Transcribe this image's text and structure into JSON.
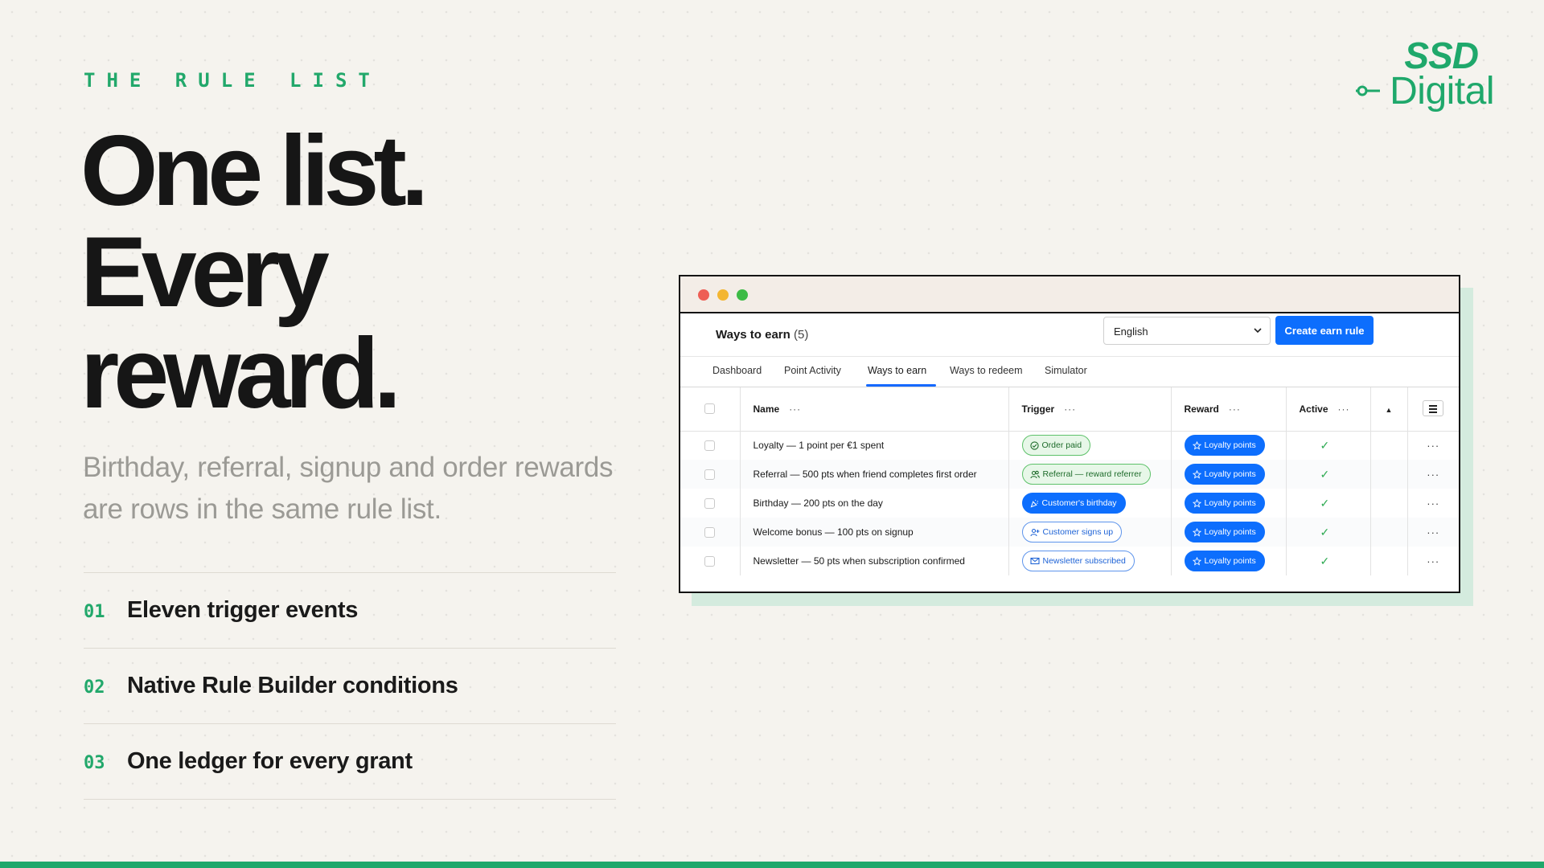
{
  "slide": {
    "eyebrow": "THE RULE LIST",
    "headline": [
      "One list.",
      "Every",
      "reward."
    ],
    "subtitle": "Birthday, referral, signup and order rewards are rows in the same rule list.",
    "features": [
      {
        "num": "01",
        "text": "Eleven trigger events"
      },
      {
        "num": "02",
        "text": "Native Rule Builder conditions"
      },
      {
        "num": "03",
        "text": "One ledger for every grant"
      }
    ]
  },
  "logo": {
    "line1": "SSD",
    "line2": "Digital"
  },
  "colors": {
    "accent": "#1fa86b",
    "primary_button": "#0d6efd",
    "shadow": "#d4ebde"
  },
  "app": {
    "title": "Ways to earn",
    "count": "(5)",
    "language_select": "English",
    "create_button": "Create earn rule",
    "tabs": [
      "Dashboard",
      "Point Activity",
      "Ways to earn",
      "Ways to redeem",
      "Simulator"
    ],
    "active_tab": "Ways to earn",
    "columns": {
      "name": "Name",
      "trigger": "Trigger",
      "reward": "Reward",
      "active": "Active"
    },
    "rows": [
      {
        "name": "Loyalty — 1 point per €1 spent",
        "trigger": "Order paid",
        "trigger_style": "green",
        "trigger_icon": "check-circle-icon",
        "reward": "Loyalty points",
        "active": true
      },
      {
        "name": "Referral — 500 pts when friend completes first order",
        "trigger": "Referral — reward referrer",
        "trigger_style": "green",
        "trigger_icon": "users-icon",
        "reward": "Loyalty points",
        "active": true
      },
      {
        "name": "Birthday — 200 pts on the day",
        "trigger": "Customer's birthday",
        "trigger_style": "blue-solid",
        "trigger_icon": "party-icon",
        "reward": "Loyalty points",
        "active": true
      },
      {
        "name": "Welcome bonus — 100 pts on signup",
        "trigger": "Customer signs up",
        "trigger_style": "blue-outline",
        "trigger_icon": "user-plus-icon",
        "reward": "Loyalty points",
        "active": true
      },
      {
        "name": "Newsletter — 50 pts when subscription confirmed",
        "trigger": "Newsletter subscribed",
        "trigger_style": "blue-outline",
        "trigger_icon": "mail-icon",
        "reward": "Loyalty points",
        "active": true
      }
    ]
  }
}
